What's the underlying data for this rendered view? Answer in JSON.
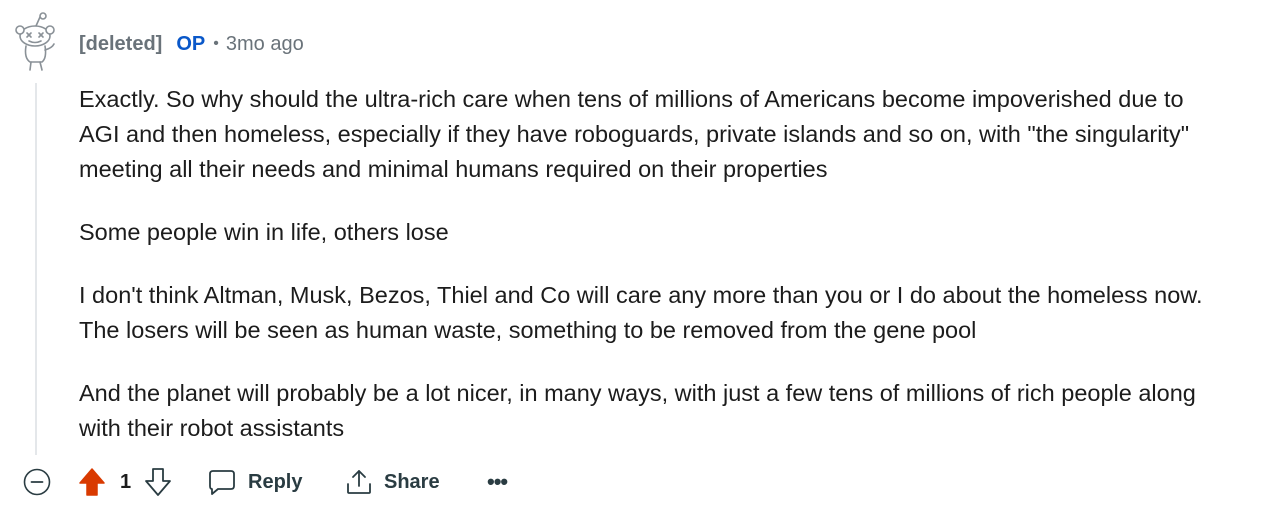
{
  "comment": {
    "author": "[deleted]",
    "op_badge": "OP",
    "separator": "•",
    "age": "3mo ago",
    "paragraphs": [
      "Exactly. So why should the ultra-rich care when tens of millions of Americans become impoverished due to AGI and then homeless, especially if they have roboguards, private islands and so on, with \"the singularity\" meeting all their needs and minimal humans required on their properties",
      "Some people win in life, others lose",
      "I don't think Altman, Musk, Bezos, Thiel and Co will care any more than you or I do about the homeless now. The losers will be seen as human waste, something to be removed from the gene pool",
      "And the planet will probably be a lot nicer, in many ways, with just a few tens of millions of rich people along with their robot assistants"
    ]
  },
  "actions": {
    "score": "1",
    "reply_label": "Reply",
    "share_label": "Share",
    "more_label": "•••"
  },
  "colors": {
    "upvote_active": "#d93a00",
    "op": "#0a58c9",
    "meta": "#6a737a",
    "thread_line": "#e4e7ea"
  },
  "icons": {
    "avatar": "snoo-deleted-avatar",
    "collapse": "minus-circle-icon",
    "upvote": "upvote-arrow-icon",
    "downvote": "downvote-arrow-icon",
    "reply": "speech-bubble-icon",
    "share": "share-upload-icon"
  }
}
